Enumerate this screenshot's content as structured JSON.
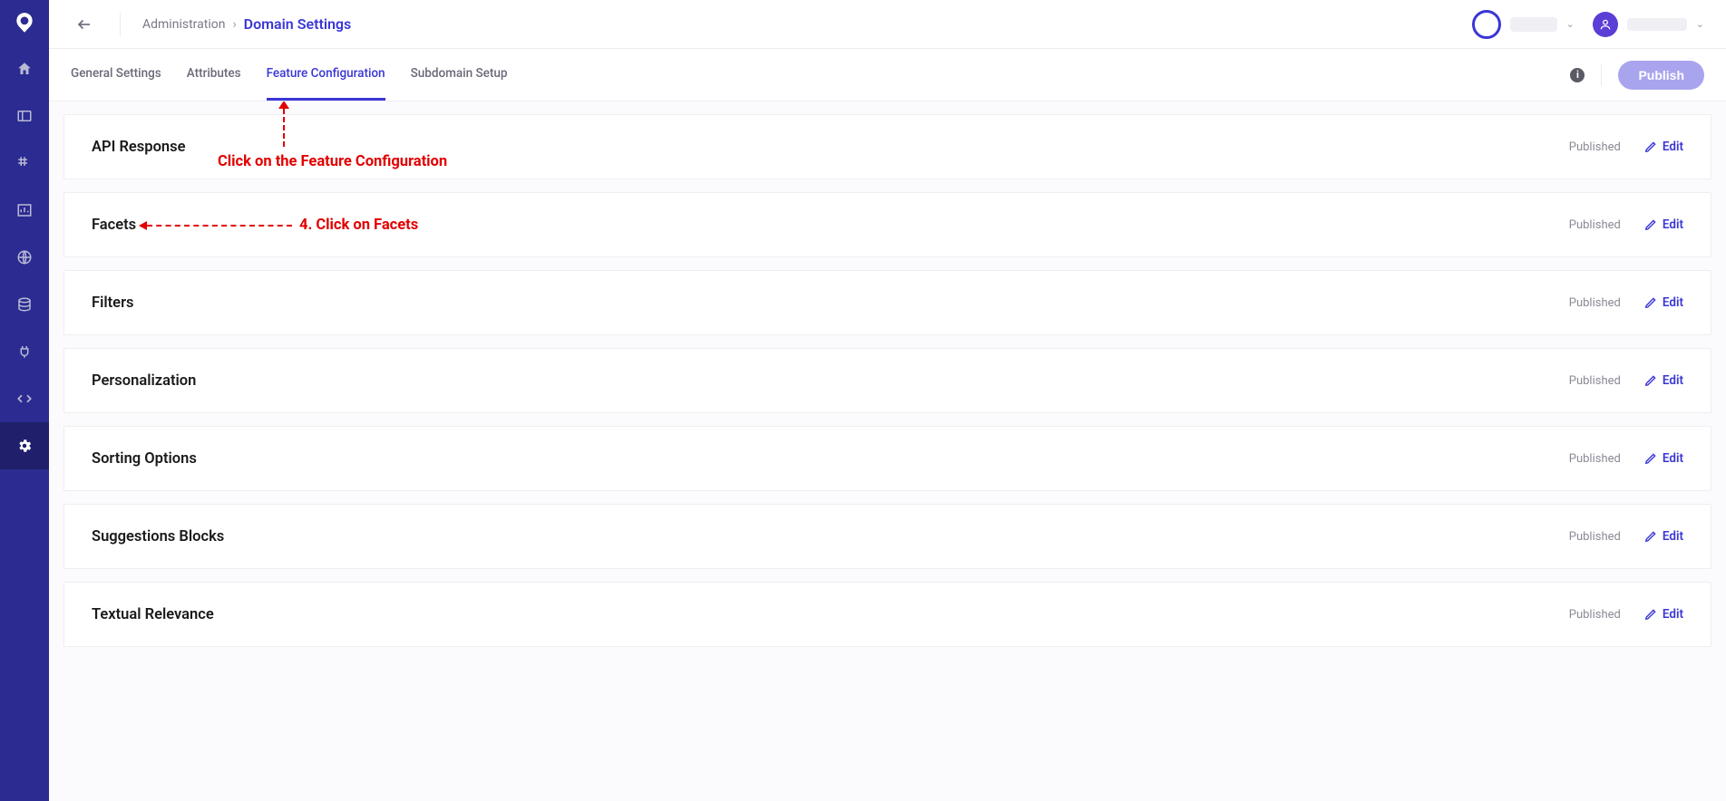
{
  "breadcrumb": {
    "parent": "Administration",
    "current": "Domain Settings"
  },
  "tabs": [
    {
      "label": "General Settings"
    },
    {
      "label": "Attributes"
    },
    {
      "label": "Feature Configuration"
    },
    {
      "label": "Subdomain Setup"
    }
  ],
  "publish_label": "Publish",
  "cards": [
    {
      "title": "API Response",
      "status": "Published",
      "edit": "Edit"
    },
    {
      "title": "Facets",
      "status": "Published",
      "edit": "Edit"
    },
    {
      "title": "Filters",
      "status": "Published",
      "edit": "Edit"
    },
    {
      "title": "Personalization",
      "status": "Published",
      "edit": "Edit"
    },
    {
      "title": "Sorting Options",
      "status": "Published",
      "edit": "Edit"
    },
    {
      "title": "Suggestions Blocks",
      "status": "Published",
      "edit": "Edit"
    },
    {
      "title": "Textual Relevance",
      "status": "Published",
      "edit": "Edit"
    }
  ],
  "annotations": {
    "tab_hint": "Click on the Feature Configuration",
    "facets_hint": "4. Click on Facets"
  },
  "info_char": "i"
}
